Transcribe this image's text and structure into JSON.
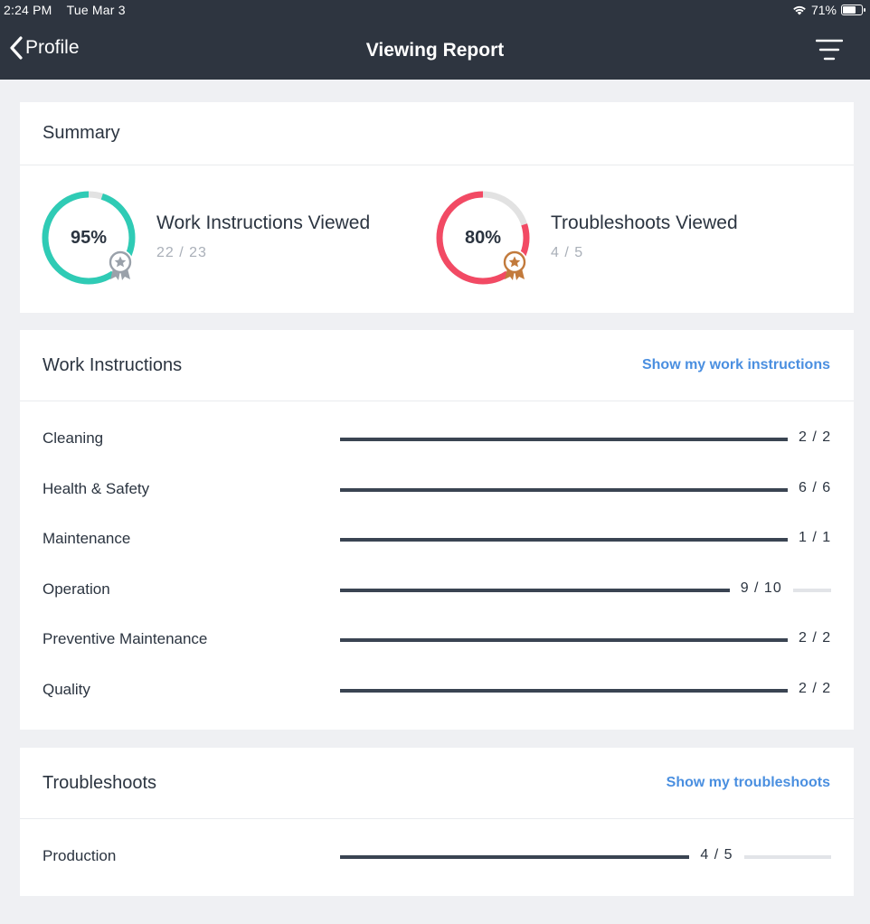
{
  "status_bar": {
    "time": "2:24 PM",
    "date": "Tue Mar 3",
    "battery": "71%",
    "battery_level": 0.71,
    "wifi_icon": "wifi-icon"
  },
  "nav": {
    "back_label": "Profile",
    "title": "Viewing Report",
    "menu_icon": "filter-menu-icon"
  },
  "colors": {
    "topbar": "#2e3540",
    "teal": "#2fcbb5",
    "red": "#f24a64",
    "track": "#e2e2e2",
    "link": "#4a8fe0",
    "bar": "#3a4452",
    "silver_medal": "#9aa1aa",
    "bronze_medal": "#c27a3c"
  },
  "summary": {
    "title": "Summary",
    "items": [
      {
        "percent_label": "95%",
        "percent": 0.95,
        "title": "Work Instructions Viewed",
        "count": "22 / 23",
        "ring_color": "#2fcbb5",
        "medal": "silver-medal-icon"
      },
      {
        "percent_label": "80%",
        "percent": 0.8,
        "title": "Troubleshoots Viewed",
        "count": "4 / 5",
        "ring_color": "#f24a64",
        "medal": "bronze-medal-icon"
      }
    ]
  },
  "work_instructions": {
    "title": "Work Instructions",
    "link": "Show my work instructions",
    "rows": [
      {
        "label": "Cleaning",
        "value": "2 / 2",
        "fraction": 1.0
      },
      {
        "label": "Health & Safety",
        "value": "6 / 6",
        "fraction": 1.0
      },
      {
        "label": "Maintenance",
        "value": "1 / 1",
        "fraction": 1.0
      },
      {
        "label": "Operation",
        "value": "9 / 10",
        "fraction": 0.9
      },
      {
        "label": "Preventive Maintenance",
        "value": "2 / 2",
        "fraction": 1.0
      },
      {
        "label": "Quality",
        "value": "2 / 2",
        "fraction": 1.0
      }
    ]
  },
  "troubleshoots": {
    "title": "Troubleshoots",
    "link": "Show my troubleshoots",
    "rows": [
      {
        "label": "Production",
        "value": "4 / 5",
        "fraction": 0.8
      }
    ]
  }
}
